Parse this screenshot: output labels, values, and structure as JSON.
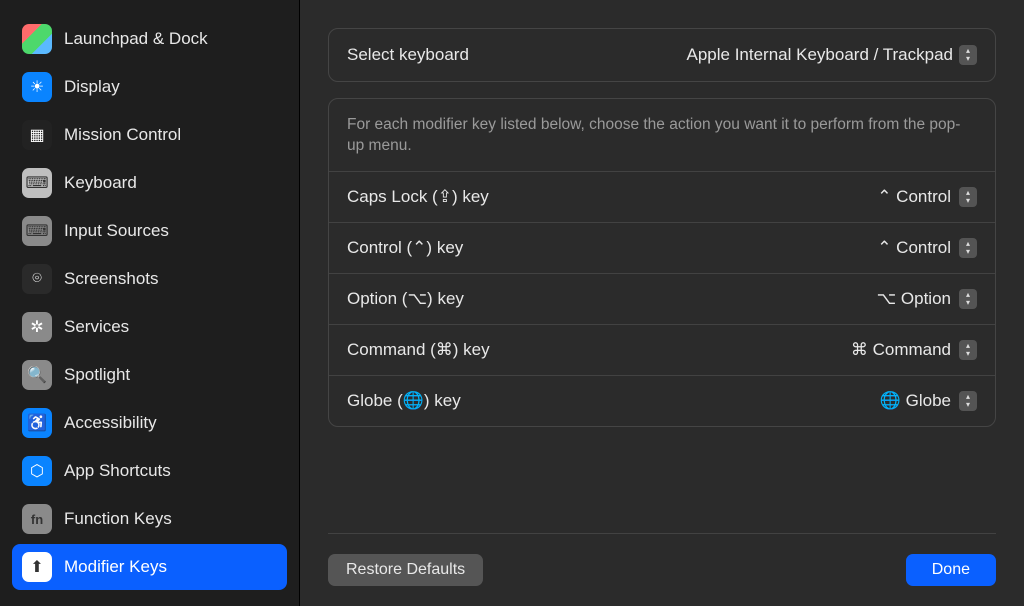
{
  "sidebar": {
    "items": [
      {
        "label": "Launchpad & Dock",
        "iconGlyph": ""
      },
      {
        "label": "Display",
        "iconGlyph": "☀"
      },
      {
        "label": "Mission Control",
        "iconGlyph": "▦"
      },
      {
        "label": "Keyboard",
        "iconGlyph": "⌨"
      },
      {
        "label": "Input Sources",
        "iconGlyph": "⌨"
      },
      {
        "label": "Screenshots",
        "iconGlyph": "⌾"
      },
      {
        "label": "Services",
        "iconGlyph": "✲"
      },
      {
        "label": "Spotlight",
        "iconGlyph": "🔍"
      },
      {
        "label": "Accessibility",
        "iconGlyph": "♿"
      },
      {
        "label": "App Shortcuts",
        "iconGlyph": "⬡"
      },
      {
        "label": "Function Keys",
        "iconGlyph": "fn"
      },
      {
        "label": "Modifier Keys",
        "iconGlyph": "⬆"
      }
    ],
    "selectedIndex": 11
  },
  "keyboardSelect": {
    "label": "Select keyboard",
    "value": "Apple Internal Keyboard / Trackpad"
  },
  "hint": "For each modifier key listed below, choose the action you want it to perform from the pop-up menu.",
  "modifiers": [
    {
      "label": "Caps Lock (⇪) key",
      "value": "⌃ Control"
    },
    {
      "label": "Control (⌃) key",
      "value": "⌃ Control"
    },
    {
      "label": "Option (⌥) key",
      "value": "⌥ Option"
    },
    {
      "label": "Command (⌘) key",
      "value": "⌘ Command"
    },
    {
      "label": "Globe (🌐) key",
      "value": "🌐 Globe"
    }
  ],
  "footer": {
    "restore": "Restore Defaults",
    "done": "Done"
  }
}
